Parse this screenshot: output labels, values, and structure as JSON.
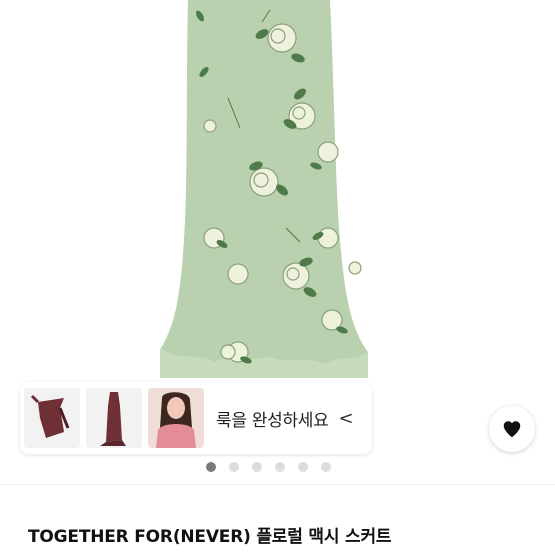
{
  "product": {
    "title": "TOGETHER FOR(NEVER) 플로럴 맥시 스커트"
  },
  "look_panel": {
    "label": "룩을 완성하세요",
    "chevron": "<",
    "thumbnails": [
      "halter-top-thumbnail",
      "halter-dress-thumbnail",
      "model-thumbnail"
    ]
  },
  "gallery": {
    "total_images": 6,
    "active_index": 1
  },
  "favorite": {
    "icon": "heart-icon"
  },
  "colors": {
    "skirt": "#b9d1ae",
    "flower": "#eef2dc",
    "leaf": "#4f7a49",
    "heart": "#111111",
    "dot_active": "#7a7a7a",
    "dot_inactive": "#dcdcdc"
  }
}
